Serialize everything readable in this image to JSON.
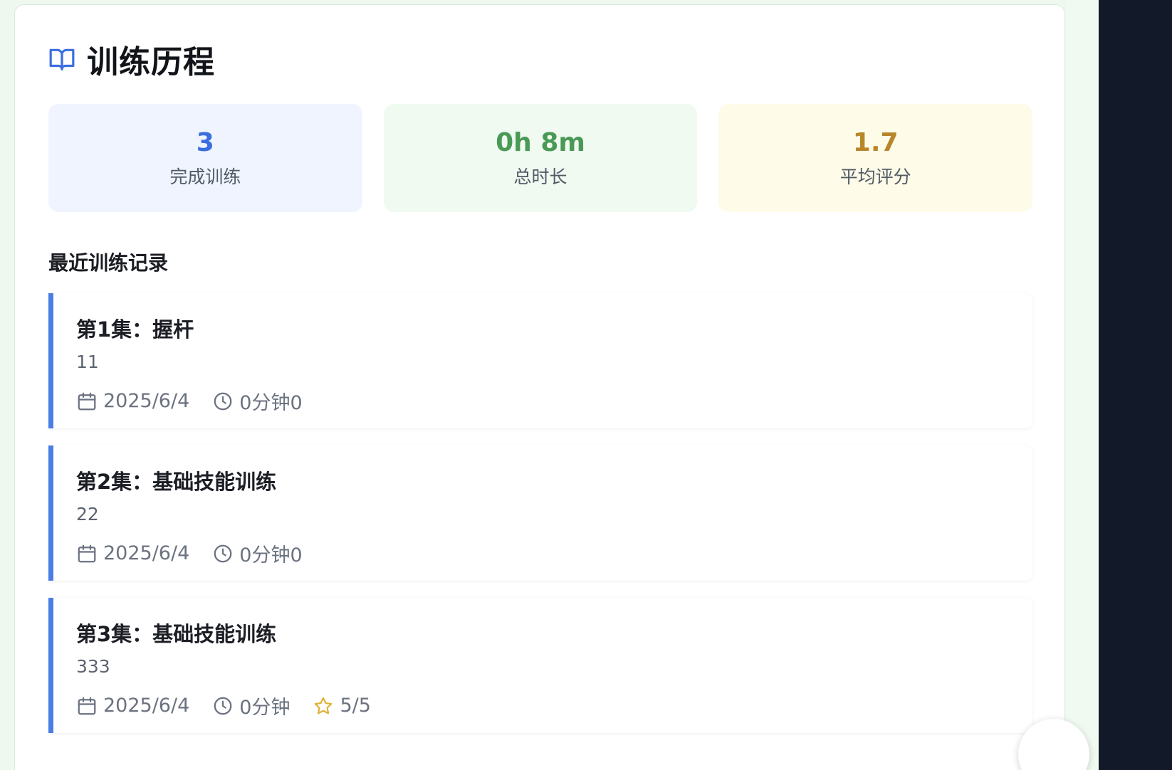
{
  "header": {
    "title": "训练历程",
    "icon": "book-open-icon",
    "icon_color": "#3b6ee0"
  },
  "stats": [
    {
      "value": "3",
      "label": "完成训练",
      "color": "#3b6ee0",
      "bg": "#eff4fe"
    },
    {
      "value": "0h 8m",
      "label": "总时长",
      "color": "#4a9a55",
      "bg": "#f0faf1"
    },
    {
      "value": "1.7",
      "label": "平均评分",
      "color": "#b8862a",
      "bg": "#fefce9"
    }
  ],
  "recent": {
    "title": "最近训练记录",
    "items": [
      {
        "title": "第1集：握杆",
        "desc": "11",
        "date": "2025/6/4",
        "duration": "0分钟0",
        "rating": ""
      },
      {
        "title": "第2集：基础技能训练",
        "desc": "22",
        "date": "2025/6/4",
        "duration": "0分钟0",
        "rating": ""
      },
      {
        "title": "第3集：基础技能训练",
        "desc": "333",
        "date": "2025/6/4",
        "duration": "0分钟",
        "rating": "5/5"
      }
    ]
  },
  "accent_color": "#4a7de6"
}
